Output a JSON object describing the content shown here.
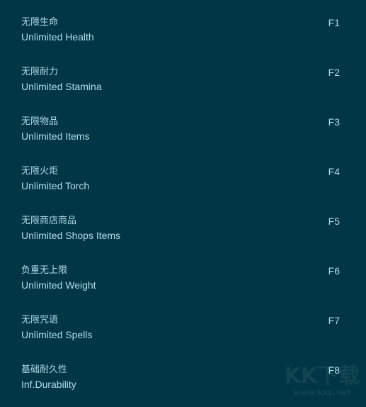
{
  "cheats": [
    {
      "cn": "无限生命",
      "en": "Unlimited Health",
      "key": "F1"
    },
    {
      "cn": "无限耐力",
      "en": "Unlimited Stamina",
      "key": "F2"
    },
    {
      "cn": "无限物品",
      "en": "Unlimited Items",
      "key": "F3"
    },
    {
      "cn": "无限火炬",
      "en": "Unlimited Torch",
      "key": "F4"
    },
    {
      "cn": "无限商店商品",
      "en": "Unlimited Shops Items",
      "key": "F5"
    },
    {
      "cn": "负重无上限",
      "en": "Unlimited Weight",
      "key": "F6"
    },
    {
      "cn": "无限咒语",
      "en": "Unlimited Spells",
      "key": "F7"
    },
    {
      "cn": "基础耐久性",
      "en": "Inf.Durability",
      "key": "F8"
    }
  ],
  "watermark": {
    "logo": "KK下载",
    "url": "www.kkx.net"
  }
}
